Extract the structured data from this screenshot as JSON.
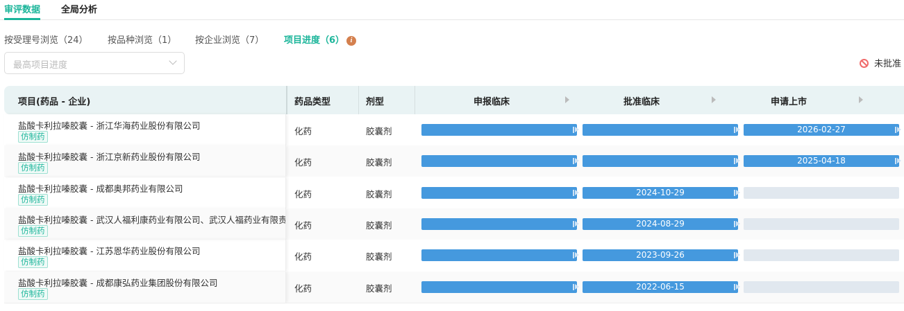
{
  "tabs": [
    {
      "label": "审评数据",
      "active": true
    },
    {
      "label": "全局分析",
      "active": false
    }
  ],
  "subtabs": [
    {
      "label": "按受理号浏览（24）"
    },
    {
      "label": "按品种浏览（1）"
    },
    {
      "label": "按企业浏览（7）"
    },
    {
      "label": "项目进度（6）",
      "active": true,
      "info": "i"
    }
  ],
  "filter": {
    "placeholder": "最高项目进度"
  },
  "legend": {
    "label": "未批准",
    "icon": "ban-icon",
    "color": "#f06a6a"
  },
  "table": {
    "headers": [
      "项目(药品 - 企业)",
      "药品类型",
      "剂型",
      "申报临床",
      "批准临床",
      "申请上市"
    ],
    "rows": [
      {
        "name": "盐酸卡利拉嗪胶囊 - 浙江华海药业股份有限公司",
        "badge": "仿制药",
        "type": "化药",
        "form": "胶囊剂",
        "stages": [
          {
            "state": "done",
            "date": ""
          },
          {
            "state": "done",
            "date": ""
          },
          {
            "state": "done",
            "date": "2026-02-27"
          }
        ]
      },
      {
        "name": "盐酸卡利拉嗪胶囊 - 浙江京新药业股份有限公司",
        "badge": "仿制药",
        "type": "化药",
        "form": "胶囊剂",
        "stages": [
          {
            "state": "done",
            "date": ""
          },
          {
            "state": "done",
            "date": ""
          },
          {
            "state": "done",
            "date": "2025-04-18"
          }
        ]
      },
      {
        "name": "盐酸卡利拉嗪胶囊 - 成都奥邦药业有限公司",
        "badge": "仿制药",
        "type": "化药",
        "form": "胶囊剂",
        "stages": [
          {
            "state": "done",
            "date": ""
          },
          {
            "state": "current",
            "date": "2024-10-29"
          },
          {
            "state": "empty",
            "date": ""
          }
        ]
      },
      {
        "name": "盐酸卡利拉嗪胶囊 - 武汉人福利康药业有限公司、武汉人福药业有限责任公司",
        "badge": "仿制药",
        "type": "化药",
        "form": "胶囊剂",
        "stages": [
          {
            "state": "done",
            "date": ""
          },
          {
            "state": "current",
            "date": "2024-08-29"
          },
          {
            "state": "empty",
            "date": ""
          }
        ]
      },
      {
        "name": "盐酸卡利拉嗪胶囊 - 江苏恩华药业股份有限公司",
        "badge": "仿制药",
        "type": "化药",
        "form": "胶囊剂",
        "stages": [
          {
            "state": "done",
            "date": ""
          },
          {
            "state": "current",
            "date": "2023-09-26"
          },
          {
            "state": "empty",
            "date": ""
          }
        ]
      },
      {
        "name": "盐酸卡利拉嗪胶囊 - 成都康弘药业集团股份有限公司",
        "badge": "仿制药",
        "type": "化药",
        "form": "胶囊剂",
        "stages": [
          {
            "state": "done",
            "date": ""
          },
          {
            "state": "current",
            "date": "2022-06-15"
          },
          {
            "state": "empty",
            "date": ""
          }
        ]
      }
    ]
  }
}
